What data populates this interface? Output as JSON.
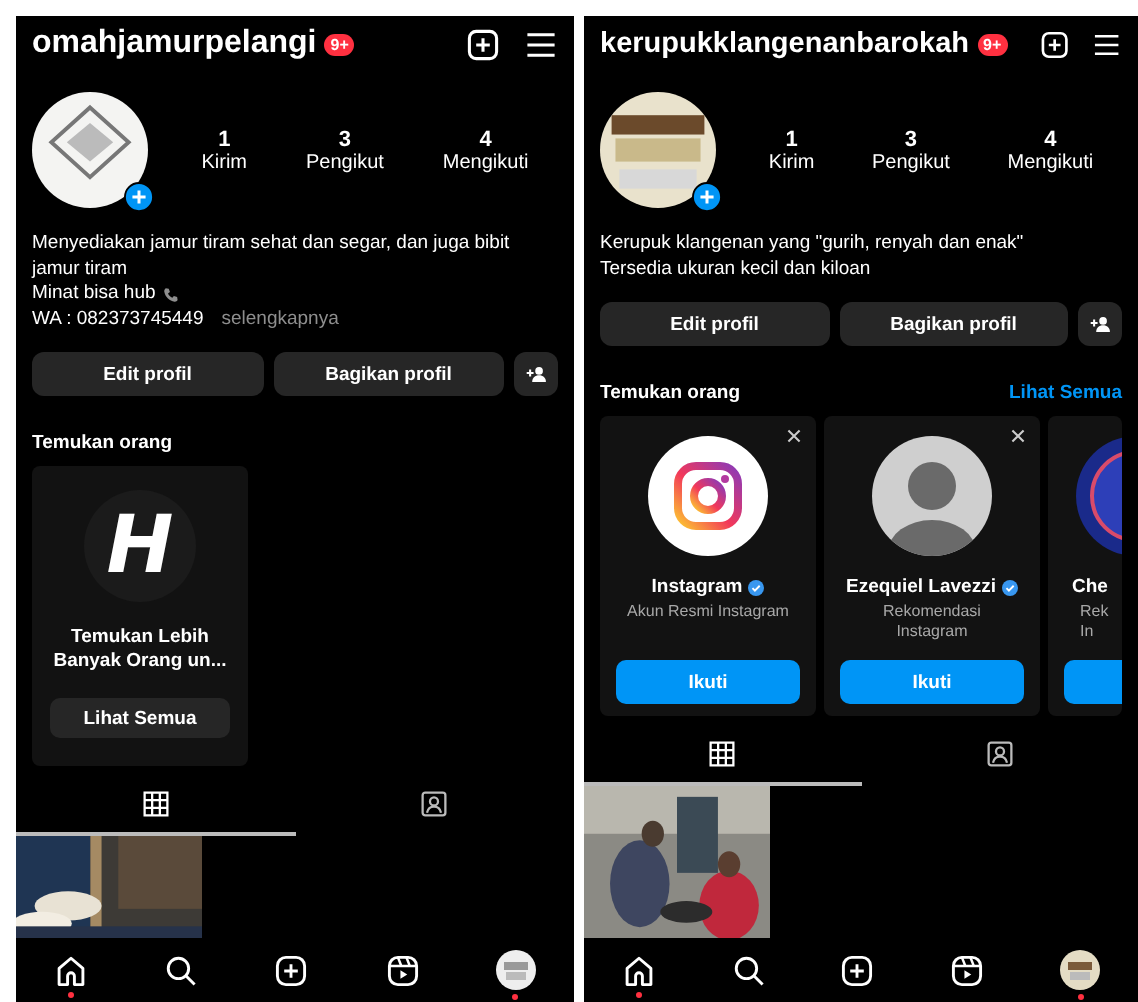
{
  "screens": [
    {
      "header": {
        "username": "omahjamurpelangi",
        "badge": "9+"
      },
      "stats": [
        {
          "value": "1",
          "label": "Kirim"
        },
        {
          "value": "3",
          "label": "Pengikut"
        },
        {
          "value": "4",
          "label": "Mengikuti"
        }
      ],
      "bio": [
        {
          "text": "Menyediakan jamur tiram sehat dan segar, dan juga bibit jamur tiram",
          "phone_icon": false
        },
        {
          "text": "Minat bisa hub",
          "phone_icon": true
        },
        {
          "text": "WA : 082373745449",
          "more": "selengkapnya",
          "phone_icon": false
        }
      ],
      "buttons": [
        "Edit profil",
        "Bagikan profil"
      ],
      "discover": {
        "title": "Temukan orang",
        "cards": [
          {
            "kind": "more",
            "logo": "H",
            "title": "Temukan Lebih\nBanyak Orang un...",
            "button": "Lihat Semua"
          }
        ]
      },
      "tabs": [
        {
          "kind": "grid",
          "selected": true
        },
        {
          "kind": "tagged",
          "selected": false
        }
      ],
      "posts": [
        {
          "kind": "picture"
        }
      ],
      "nav": [
        {
          "kind": "home",
          "notification": true
        },
        {
          "kind": "search",
          "notification": false
        },
        {
          "kind": "create",
          "notification": false
        },
        {
          "kind": "reels",
          "notification": false
        },
        {
          "kind": "profile",
          "notification": true
        }
      ]
    },
    {
      "header": {
        "username": "kerupukklangenanbarokah",
        "badge": "9+"
      },
      "stats": [
        {
          "value": "1",
          "label": "Kirim"
        },
        {
          "value": "3",
          "label": "Pengikut"
        },
        {
          "value": "4",
          "label": "Mengikuti"
        }
      ],
      "bio": [
        {
          "text": "Kerupuk klangenan yang \"gurih, renyah dan enak\"",
          "phone_icon": false
        },
        {
          "text": "Tersedia ukuran kecil dan kiloan",
          "phone_icon": false
        }
      ],
      "buttons": [
        "Edit profil",
        "Bagikan profil"
      ],
      "discover": {
        "title": "Temukan orang",
        "see_all": "Lihat Semua",
        "cards": [
          {
            "kind": "official",
            "name": "Instagram",
            "verified": true,
            "subtitle": "Akun Resmi Instagram",
            "button": "Ikuti"
          },
          {
            "kind": "person",
            "name": "Ezequiel Lavezzi",
            "verified": true,
            "subtitle": "Rekomendasi\nInstagram",
            "button": "Ikuti"
          },
          {
            "kind": "cut",
            "name": "Che",
            "verified": false,
            "subtitle": "Rek\nIn"
          }
        ]
      },
      "tabs": [
        {
          "kind": "grid",
          "selected": true
        },
        {
          "kind": "tagged",
          "selected": false
        }
      ],
      "posts": [
        {
          "kind": "picture"
        }
      ],
      "nav": [
        {
          "kind": "home",
          "notification": true
        },
        {
          "kind": "search",
          "notification": false
        },
        {
          "kind": "create",
          "notification": false
        },
        {
          "kind": "reels",
          "notification": false
        },
        {
          "kind": "profile",
          "notification": true
        }
      ]
    }
  ]
}
